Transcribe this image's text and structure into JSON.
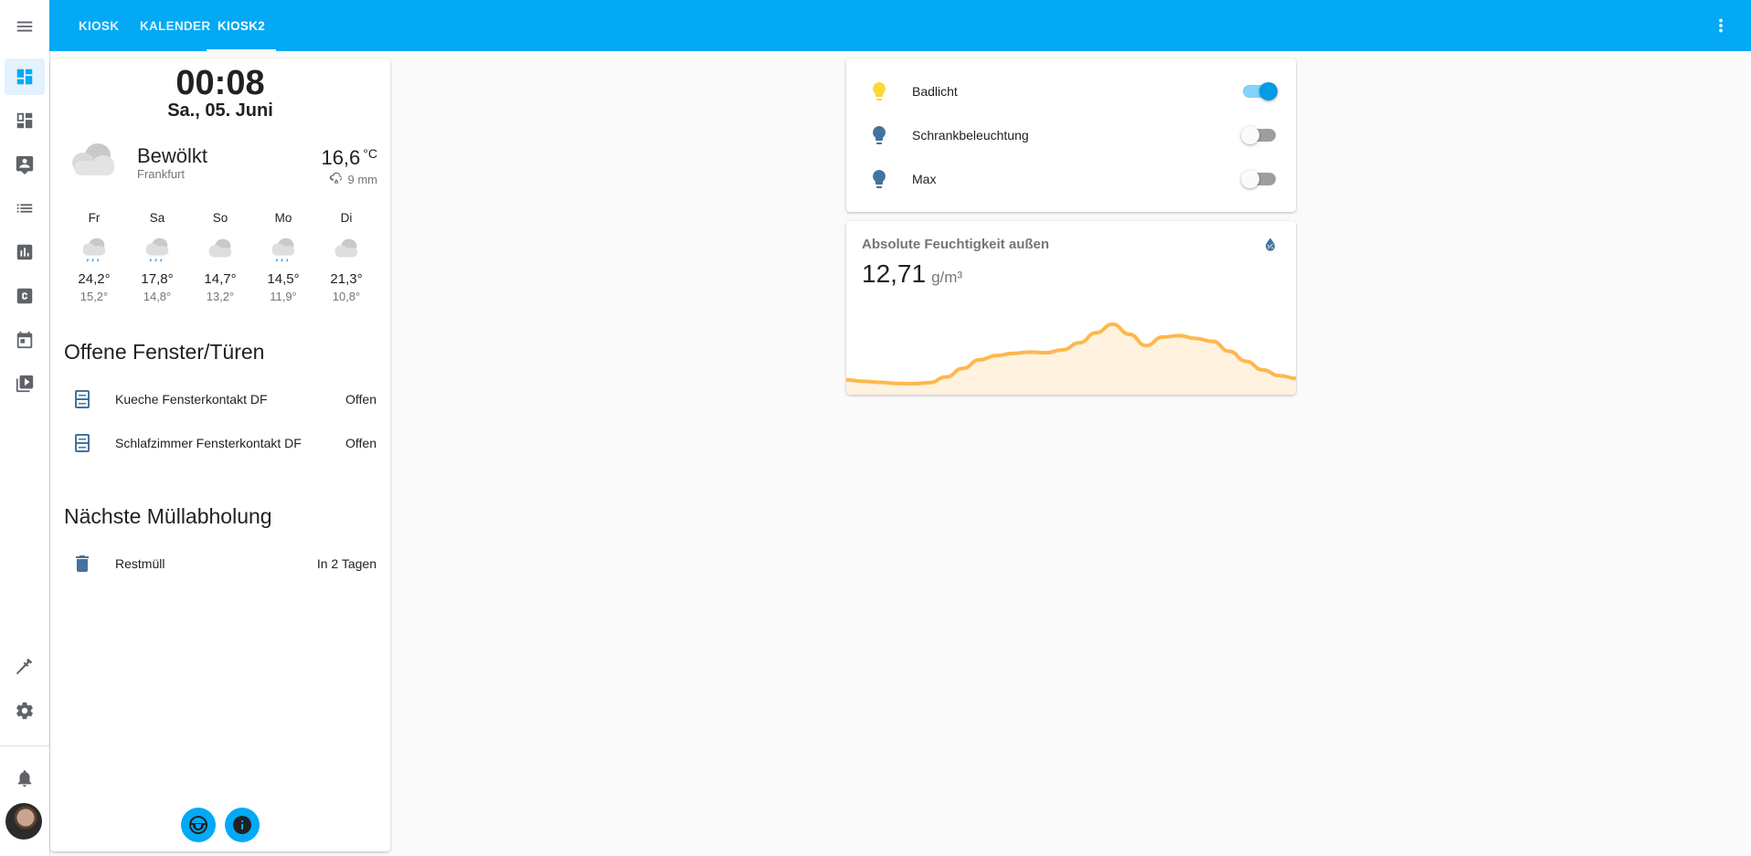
{
  "header": {
    "tabs": [
      {
        "label": "KIOSK",
        "active": false
      },
      {
        "label": "KALENDER",
        "active": false
      },
      {
        "label": "KIOSK2",
        "active": true
      }
    ],
    "accent_color": "#03a9f4"
  },
  "sidebar": {
    "icons": [
      "menu-icon",
      "dashboard-icon",
      "dashboard-alt-icon",
      "person-badge-icon",
      "list-icon",
      "chart-icon",
      "c-box-icon",
      "calendar-icon",
      "media-icon",
      "hammer-icon",
      "gear-icon",
      "bell-icon"
    ]
  },
  "clock": {
    "time": "00:08",
    "date": "Sa., 05. Juni"
  },
  "weather": {
    "state": "Bewölkt",
    "location": "Frankfurt",
    "temperature": "16,6",
    "unit": "°C",
    "precipitation": "9 mm",
    "forecast": [
      {
        "day": "Fr",
        "high": "24,2°",
        "low": "15,2°",
        "icon": "cloud-rain-icon"
      },
      {
        "day": "Sa",
        "high": "17,8°",
        "low": "14,8°",
        "icon": "cloud-rain-icon"
      },
      {
        "day": "So",
        "high": "14,7°",
        "low": "13,2°",
        "icon": "cloud-icon"
      },
      {
        "day": "Mo",
        "high": "14,5°",
        "low": "11,9°",
        "icon": "cloud-rain-icon"
      },
      {
        "day": "Di",
        "high": "21,3°",
        "low": "10,8°",
        "icon": "cloud-icon"
      }
    ]
  },
  "windows": {
    "title": "Offene Fenster/Türen",
    "items": [
      {
        "name": "Kueche Fensterkontakt DF",
        "state": "Offen"
      },
      {
        "name": "Schlafzimmer Fensterkontakt DF",
        "state": "Offen"
      }
    ]
  },
  "garbage": {
    "title": "Nächste Müllabholung",
    "items": [
      {
        "name": "Restmüll",
        "state": "In 2 Tagen"
      }
    ]
  },
  "lights": [
    {
      "name": "Badlicht",
      "on": true,
      "color": "#fdd835"
    },
    {
      "name": "Schrankbeleuchtung",
      "on": false,
      "color": "#44739e"
    },
    {
      "name": "Max",
      "on": false,
      "color": "#44739e"
    }
  ],
  "sensor": {
    "name": "Absolute Feuchtigkeit außen",
    "value": "12,71",
    "unit": "g/m³",
    "line_color": "#ffb74d",
    "fill_color": "#fff3e0",
    "history": [
      0.08,
      0.06,
      0.045,
      0.03,
      0.025,
      0.04,
      0.12,
      0.24,
      0.36,
      0.42,
      0.45,
      0.47,
      0.46,
      0.5,
      0.6,
      0.74,
      0.86,
      0.72,
      0.56,
      0.68,
      0.7,
      0.66,
      0.62,
      0.48,
      0.34,
      0.22,
      0.14,
      0.1
    ]
  }
}
